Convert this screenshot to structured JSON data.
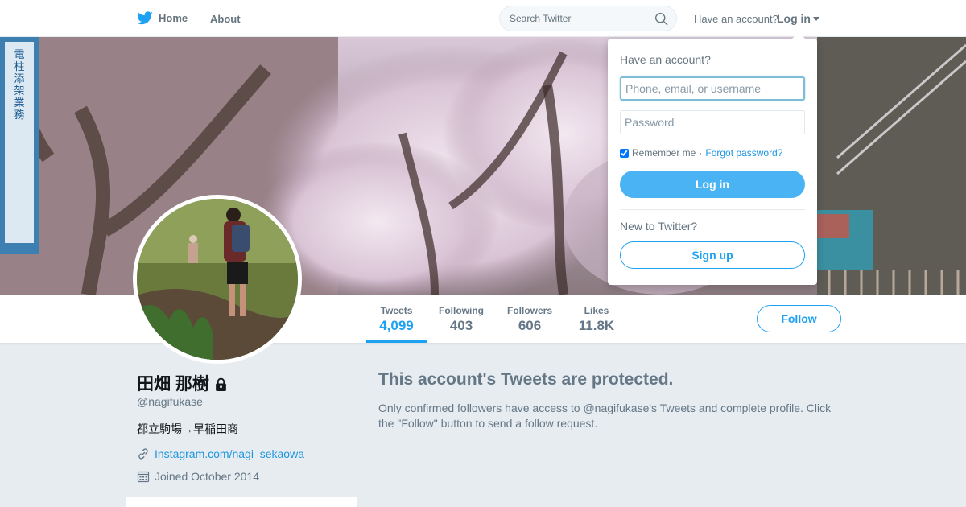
{
  "nav": {
    "home_label": "Home",
    "about_label": "About",
    "search_placeholder": "Search Twitter",
    "have_account": "Have an account?",
    "login_label": "Log in"
  },
  "profile": {
    "name": "田畑 那樹",
    "handle": "@nagifukase",
    "bio": "都立駒場→早稲田商",
    "link": "Instagram.com/nagi_sekaowa",
    "joined": "Joined October 2014",
    "protected": true
  },
  "stats": [
    {
      "label": "Tweets",
      "value": "4,099",
      "active": true
    },
    {
      "label": "Following",
      "value": "403",
      "active": false
    },
    {
      "label": "Followers",
      "value": "606",
      "active": false
    },
    {
      "label": "Likes",
      "value": "11.8K",
      "active": false
    }
  ],
  "follow_label": "Follow",
  "protected_notice": {
    "title": "This account's Tweets are protected.",
    "body": "Only confirmed followers have access to @nagifukase's Tweets and complete profile. Click the \"Follow\" button to send a follow request."
  },
  "login_dropdown": {
    "heading": "Have an account?",
    "username_placeholder": "Phone, email, or username",
    "password_placeholder": "Password",
    "remember_label": "Remember me",
    "separator": "·",
    "forgot_label": "Forgot password?",
    "remember_checked": true,
    "login_button": "Log in",
    "new_heading": "New to Twitter?",
    "signup_button": "Sign up"
  },
  "banner": {
    "sign_text": "電柱添架業務"
  },
  "colors": {
    "brand": "#1da1f2",
    "link": "#1b95e0",
    "page_bg": "#e6ecf0",
    "muted": "#657786"
  },
  "icons": {
    "logo": "twitter-bird-icon",
    "search": "search-icon",
    "lock": "lock-icon",
    "link": "link-icon",
    "calendar": "calendar-icon",
    "dropdown": "caret-down-icon"
  }
}
